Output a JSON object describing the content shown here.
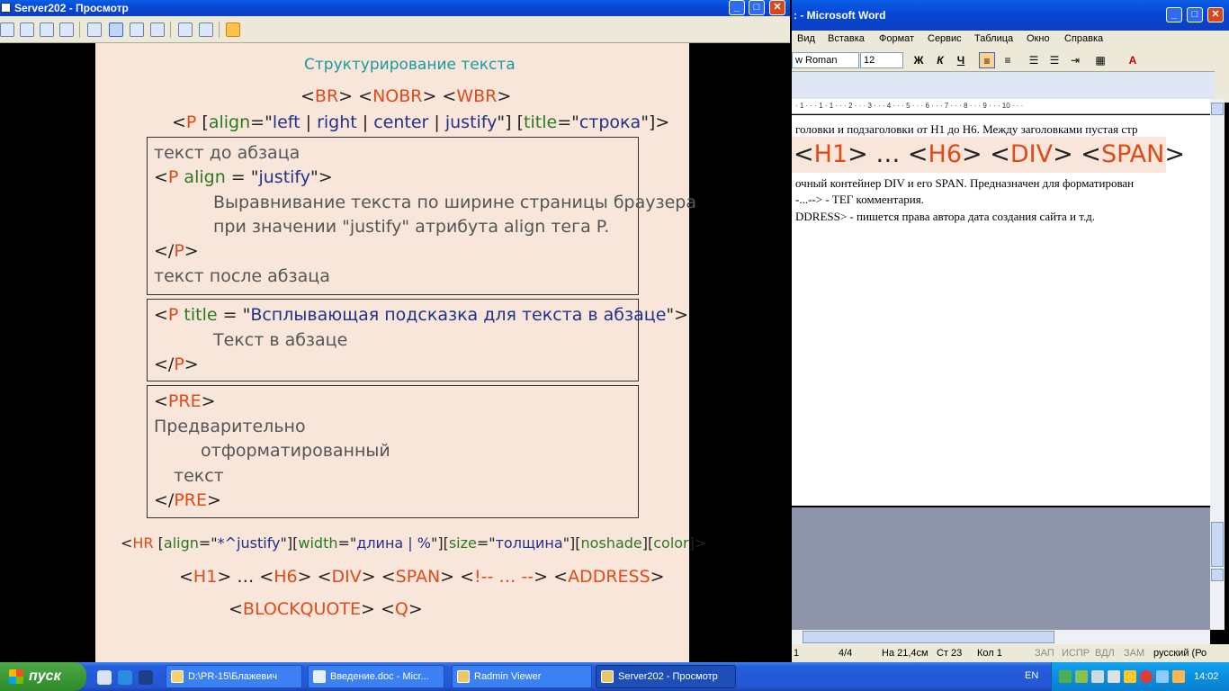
{
  "radmin": {
    "title": "Server202 - Просмотр",
    "buttons": {
      "min": "_",
      "max": "□",
      "close": "✕"
    }
  },
  "slide": {
    "heading": "Структурирование текста",
    "line1": [
      "<",
      "BR",
      "> <",
      "NOBR",
      "> <",
      "WBR",
      ">"
    ],
    "line2": {
      "p1": "<",
      "tag": "P",
      "sp": " [",
      "attr": "align",
      "eq": "=\"",
      "v1": "left",
      "s1": " | ",
      "v2": "right",
      "s2": " | ",
      "v3": "center",
      "s3": " | ",
      "v4": "justify",
      "e1": "\"] [",
      "attr2": "title",
      "eq2": "=\"",
      "v5": "строка",
      "e2": "\"]>"
    },
    "box1": {
      "l1": "текст до абзаца",
      "l2a": "<",
      "l2tag": "P",
      "l2attr": " align",
      "l2eq": " = \"",
      "l2val": "justify",
      "l2end": "\">",
      "l3": "Выравнивание текста по ширине страницы браузера",
      "l4": "при значении \"justify\" атрибута align тега P.",
      "l5a": "</",
      "l5tag": "P",
      "l5b": ">",
      "l6": "текст после абзаца"
    },
    "box2": {
      "l1a": "<",
      "l1tag": "P",
      "l1attr": " title",
      "l1eq": " = \"",
      "l1val": "Всплывающая подсказка для текста в абзаце",
      "l1end": "\">",
      "l2": "Текст в абзаце",
      "l3a": "</",
      "l3tag": "P",
      "l3b": ">"
    },
    "box3": {
      "l1a": "<",
      "l1tag": "PRE",
      "l1b": ">",
      "l2": "Предварительно",
      "l3": "отформатированный",
      "l4": "текст",
      "l5a": "</",
      "l5tag": "PRE",
      "l5b": ">"
    },
    "hr": {
      "a": "<",
      "tag": "HR",
      "b": " [",
      "at1": "align",
      "e1": "=\"",
      "v1": "*^justify",
      "c1": "\"][",
      "at2": "width",
      "e2": "=\"",
      "v2": "длина | %",
      "c2": "\"][",
      "at3": "size",
      "e3": "=\"",
      "v3": "толщина",
      "c3": "\"][",
      "at4": "noshade",
      "c4": "][",
      "at5": "color",
      "c5": "]>"
    },
    "line_h": {
      "a": "<",
      "t1": "H1",
      "b": "> … <",
      "t2": "H6",
      "c": "> <",
      "t3": "DIV",
      "d": "> <",
      "t4": "SPAN",
      "e": "> <",
      "t5": "!-- … --",
      "f": "> <",
      "t6": "ADDRESS",
      "g": ">"
    },
    "line_bq": {
      "a": "<",
      "t1": "BLOCKQUOTE",
      "b": "> <",
      "t2": "Q",
      "c": ">"
    }
  },
  "word": {
    "title": ": - Microsoft Word",
    "menu": [
      "Вид",
      "Вставка",
      "Формат",
      "Сервис",
      "Таблица",
      "Окно",
      "Справка"
    ],
    "font": "w Roman",
    "size": "12",
    "fmt": {
      "bold": "Ж",
      "italic": "К",
      "underline": "Ч"
    },
    "doc": {
      "l1": "головки и подзаголовки от H1 до H6. Между заголовками пустая стр",
      "hl": {
        "a": "<",
        "t1": "H1",
        "b": "> … <",
        "t2": "H6",
        "c": "> <",
        "t3": "DIV",
        "d": "> <",
        "t4": "SPAN",
        "e": ">"
      },
      "l2": "очный контейнер DIV и его SPAN. Предназначен для форматирован",
      "l3": "-...--> - ТЕГ комментария.",
      "l4": "DDRESS> - пишется права автора дата создания сайта и т.д."
    },
    "ruler": "· 1 · · · 1 · 1 · · · 2 · · · 3 · · · 4 · · · 5 · · · 6 · · · 7 · · · 8 · · · 9 · · · 10 · · ·",
    "status": {
      "page": "1",
      "pages": "4/4",
      "pos": "На 21,4см",
      "line": "Ст 23",
      "col": "Кол 1",
      "rec": "ЗАП",
      "trk": "ИСПР",
      "ext": "ВДЛ",
      "ovr": "ЗАМ",
      "lang": "русский (Ро"
    }
  },
  "taskbar": {
    "start": "пуск",
    "tasks": [
      "D:\\PR-15\\Блажевич",
      "Введение.doc - Micr...",
      "Radmin Viewer",
      "Server202 - Просмотр"
    ],
    "lang": "EN",
    "clock": "14:02"
  }
}
